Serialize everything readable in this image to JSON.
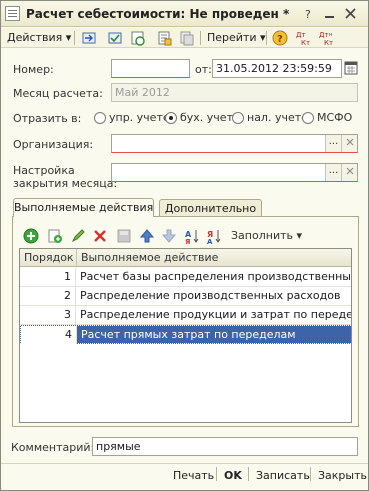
{
  "window": {
    "title": "Расчет себестоимости: Не проведен *"
  },
  "toolbar": {
    "actions_label": "Действия",
    "goto_label": "Перейти",
    "help_label": "?",
    "dt_kt_label": "Дт Кт",
    "dt_kt_n_label": "Дт н Кт"
  },
  "form": {
    "number_label": "Номер:",
    "number_value": "",
    "date_prefix": "от:",
    "date_value": "31.05.2012 23:59:59",
    "month_label": "Месяц расчета:",
    "month_value": "Май 2012",
    "reflect_label": "Отразить в:",
    "reflect_options": [
      "упр. учете",
      "бух. учете",
      "нал. учете",
      "МСФО"
    ],
    "reflect_selected": "бух. учете",
    "org_label": "Организация:",
    "org_value": "",
    "close_setup_label_1": "Настройка",
    "close_setup_label_2": "закрытия месяца:",
    "close_setup_value": "",
    "pick_glyph": "..."
  },
  "tabs": [
    "Выполняемые действия",
    "Дополнительно"
  ],
  "grid_toolbar": {
    "fill_label": "Заполнить"
  },
  "grid": {
    "columns": [
      "Порядок",
      "Выполняемое действие"
    ],
    "rows": [
      {
        "order": "1",
        "action": "Расчет базы распределения производственных ра..."
      },
      {
        "order": "2",
        "action": "Распределение производственных расходов"
      },
      {
        "order": "3",
        "action": "Распределение продукции и затрат по переделам"
      },
      {
        "order": "4",
        "action": "Расчет прямых затрат по переделам"
      }
    ],
    "selected_row": 4
  },
  "comment": {
    "label": "Комментарий:",
    "value": "прямые"
  },
  "footer": {
    "print_label": "Печать",
    "ok_label": "OK",
    "save_label": "Записать",
    "close_label": "Закрыть"
  },
  "colors": {
    "selection": "#3d64a8",
    "window_bg": "#fbfaee",
    "required_underline": "#e05050"
  }
}
